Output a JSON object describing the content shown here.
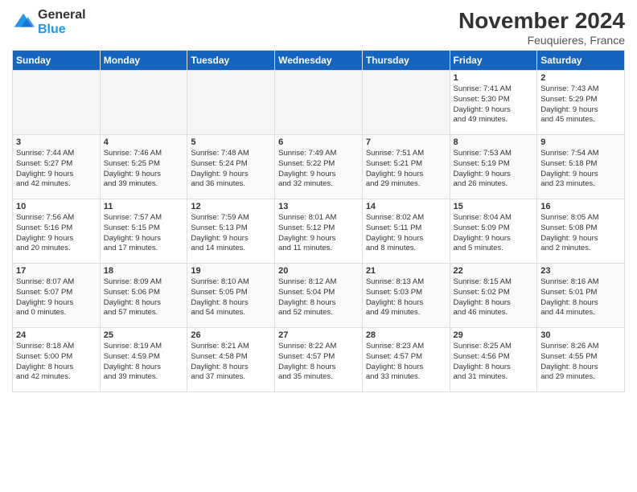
{
  "header": {
    "logo_line1": "General",
    "logo_line2": "Blue",
    "month": "November 2024",
    "location": "Feuquieres, France"
  },
  "days_of_week": [
    "Sunday",
    "Monday",
    "Tuesday",
    "Wednesday",
    "Thursday",
    "Friday",
    "Saturday"
  ],
  "weeks": [
    [
      {
        "day": "",
        "info": "",
        "empty": true
      },
      {
        "day": "",
        "info": "",
        "empty": true
      },
      {
        "day": "",
        "info": "",
        "empty": true
      },
      {
        "day": "",
        "info": "",
        "empty": true
      },
      {
        "day": "",
        "info": "",
        "empty": true
      },
      {
        "day": "1",
        "info": "Sunrise: 7:41 AM\nSunset: 5:30 PM\nDaylight: 9 hours\nand 49 minutes.",
        "empty": false
      },
      {
        "day": "2",
        "info": "Sunrise: 7:43 AM\nSunset: 5:29 PM\nDaylight: 9 hours\nand 45 minutes.",
        "empty": false
      }
    ],
    [
      {
        "day": "3",
        "info": "Sunrise: 7:44 AM\nSunset: 5:27 PM\nDaylight: 9 hours\nand 42 minutes.",
        "empty": false
      },
      {
        "day": "4",
        "info": "Sunrise: 7:46 AM\nSunset: 5:25 PM\nDaylight: 9 hours\nand 39 minutes.",
        "empty": false
      },
      {
        "day": "5",
        "info": "Sunrise: 7:48 AM\nSunset: 5:24 PM\nDaylight: 9 hours\nand 36 minutes.",
        "empty": false
      },
      {
        "day": "6",
        "info": "Sunrise: 7:49 AM\nSunset: 5:22 PM\nDaylight: 9 hours\nand 32 minutes.",
        "empty": false
      },
      {
        "day": "7",
        "info": "Sunrise: 7:51 AM\nSunset: 5:21 PM\nDaylight: 9 hours\nand 29 minutes.",
        "empty": false
      },
      {
        "day": "8",
        "info": "Sunrise: 7:53 AM\nSunset: 5:19 PM\nDaylight: 9 hours\nand 26 minutes.",
        "empty": false
      },
      {
        "day": "9",
        "info": "Sunrise: 7:54 AM\nSunset: 5:18 PM\nDaylight: 9 hours\nand 23 minutes.",
        "empty": false
      }
    ],
    [
      {
        "day": "10",
        "info": "Sunrise: 7:56 AM\nSunset: 5:16 PM\nDaylight: 9 hours\nand 20 minutes.",
        "empty": false
      },
      {
        "day": "11",
        "info": "Sunrise: 7:57 AM\nSunset: 5:15 PM\nDaylight: 9 hours\nand 17 minutes.",
        "empty": false
      },
      {
        "day": "12",
        "info": "Sunrise: 7:59 AM\nSunset: 5:13 PM\nDaylight: 9 hours\nand 14 minutes.",
        "empty": false
      },
      {
        "day": "13",
        "info": "Sunrise: 8:01 AM\nSunset: 5:12 PM\nDaylight: 9 hours\nand 11 minutes.",
        "empty": false
      },
      {
        "day": "14",
        "info": "Sunrise: 8:02 AM\nSunset: 5:11 PM\nDaylight: 9 hours\nand 8 minutes.",
        "empty": false
      },
      {
        "day": "15",
        "info": "Sunrise: 8:04 AM\nSunset: 5:09 PM\nDaylight: 9 hours\nand 5 minutes.",
        "empty": false
      },
      {
        "day": "16",
        "info": "Sunrise: 8:05 AM\nSunset: 5:08 PM\nDaylight: 9 hours\nand 2 minutes.",
        "empty": false
      }
    ],
    [
      {
        "day": "17",
        "info": "Sunrise: 8:07 AM\nSunset: 5:07 PM\nDaylight: 9 hours\nand 0 minutes.",
        "empty": false
      },
      {
        "day": "18",
        "info": "Sunrise: 8:09 AM\nSunset: 5:06 PM\nDaylight: 8 hours\nand 57 minutes.",
        "empty": false
      },
      {
        "day": "19",
        "info": "Sunrise: 8:10 AM\nSunset: 5:05 PM\nDaylight: 8 hours\nand 54 minutes.",
        "empty": false
      },
      {
        "day": "20",
        "info": "Sunrise: 8:12 AM\nSunset: 5:04 PM\nDaylight: 8 hours\nand 52 minutes.",
        "empty": false
      },
      {
        "day": "21",
        "info": "Sunrise: 8:13 AM\nSunset: 5:03 PM\nDaylight: 8 hours\nand 49 minutes.",
        "empty": false
      },
      {
        "day": "22",
        "info": "Sunrise: 8:15 AM\nSunset: 5:02 PM\nDaylight: 8 hours\nand 46 minutes.",
        "empty": false
      },
      {
        "day": "23",
        "info": "Sunrise: 8:16 AM\nSunset: 5:01 PM\nDaylight: 8 hours\nand 44 minutes.",
        "empty": false
      }
    ],
    [
      {
        "day": "24",
        "info": "Sunrise: 8:18 AM\nSunset: 5:00 PM\nDaylight: 8 hours\nand 42 minutes.",
        "empty": false
      },
      {
        "day": "25",
        "info": "Sunrise: 8:19 AM\nSunset: 4:59 PM\nDaylight: 8 hours\nand 39 minutes.",
        "empty": false
      },
      {
        "day": "26",
        "info": "Sunrise: 8:21 AM\nSunset: 4:58 PM\nDaylight: 8 hours\nand 37 minutes.",
        "empty": false
      },
      {
        "day": "27",
        "info": "Sunrise: 8:22 AM\nSunset: 4:57 PM\nDaylight: 8 hours\nand 35 minutes.",
        "empty": false
      },
      {
        "day": "28",
        "info": "Sunrise: 8:23 AM\nSunset: 4:57 PM\nDaylight: 8 hours\nand 33 minutes.",
        "empty": false
      },
      {
        "day": "29",
        "info": "Sunrise: 8:25 AM\nSunset: 4:56 PM\nDaylight: 8 hours\nand 31 minutes.",
        "empty": false
      },
      {
        "day": "30",
        "info": "Sunrise: 8:26 AM\nSunset: 4:55 PM\nDaylight: 8 hours\nand 29 minutes.",
        "empty": false
      }
    ]
  ]
}
